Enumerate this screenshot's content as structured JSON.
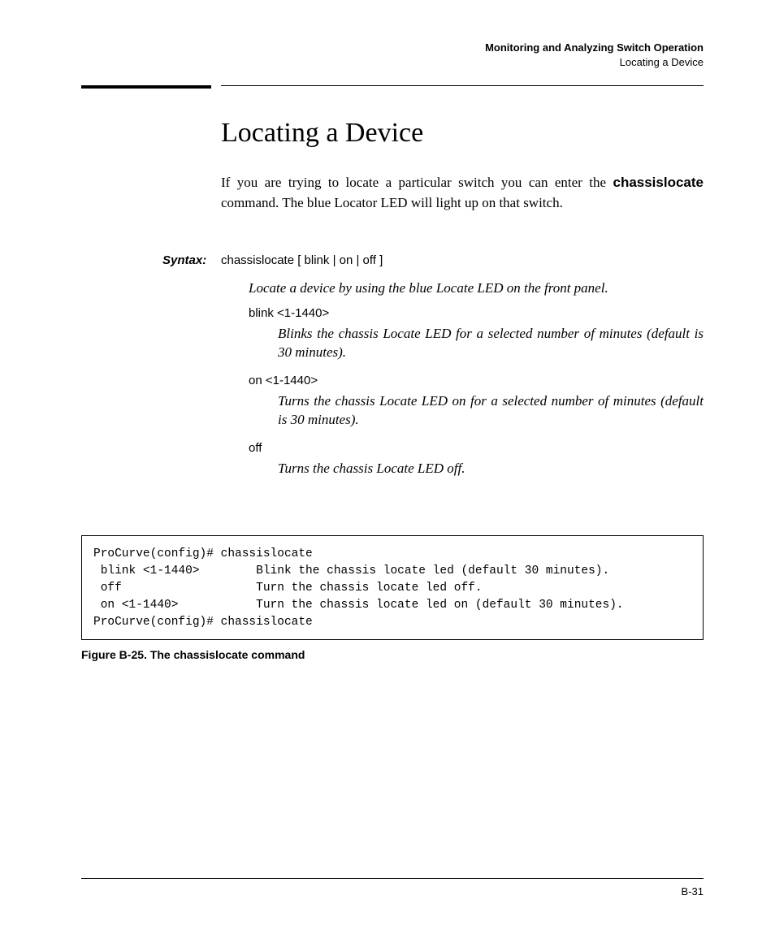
{
  "header": {
    "chapter": "Monitoring and Analyzing Switch Operation",
    "section": "Locating a Device"
  },
  "title": "Locating a Device",
  "intro_pre": "If you are trying to locate a particular switch you can enter the ",
  "intro_cmd": "chassislocate",
  "intro_post": " command. The blue Locator LED will light up on that switch.",
  "syntax": {
    "label": "Syntax:",
    "command": "chassislocate [ blink | on | off ]",
    "lead_desc": "Locate a device by using the blue Locate LED on the front panel.",
    "options": [
      {
        "term": "blink <1-1440>",
        "desc": "Blinks the chassis Locate LED for a selected number of minutes (default is 30 minutes)."
      },
      {
        "term": "on <1-1440>",
        "desc": "Turns the chassis Locate LED on for a selected number of minutes (default is 30 minutes)."
      },
      {
        "term": "off",
        "desc": "Turns the chassis Locate LED off."
      }
    ]
  },
  "terminal": "ProCurve(config)# chassislocate\n blink <1-1440>        Blink the chassis locate led (default 30 minutes).\n off                   Turn the chassis locate led off.\n on <1-1440>           Turn the chassis locate led on (default 30 minutes).\nProCurve(config)# chassislocate",
  "figure_caption": "Figure B-25.  The chassislocate command",
  "page_number": "B-31"
}
